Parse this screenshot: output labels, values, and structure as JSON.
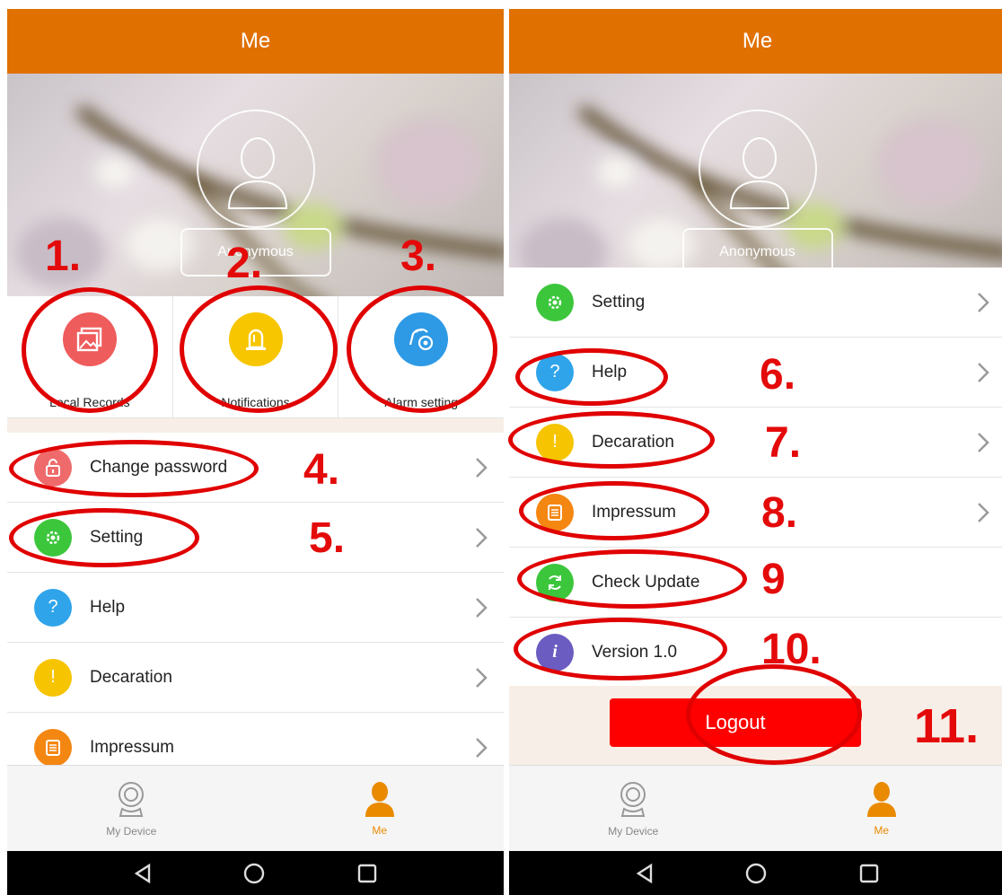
{
  "left": {
    "title": "Me",
    "user_name": "Anonymous",
    "quick_actions": [
      {
        "label": "Local Records"
      },
      {
        "label": "Notifications"
      },
      {
        "label": "Alarm setting"
      }
    ],
    "menu": [
      {
        "label": "Change password"
      },
      {
        "label": "Setting"
      },
      {
        "label": "Help"
      },
      {
        "label": "Decaration"
      },
      {
        "label": "Impressum"
      }
    ],
    "nav": [
      {
        "label": "My Device"
      },
      {
        "label": "Me"
      }
    ]
  },
  "right": {
    "title": "Me",
    "user_name": "Anonymous",
    "menu": [
      {
        "label": "Setting"
      },
      {
        "label": "Help"
      },
      {
        "label": "Decaration"
      },
      {
        "label": "Impressum"
      },
      {
        "label": "Check Update"
      },
      {
        "label": "Version 1.0"
      }
    ],
    "logout_label": "Logout",
    "nav": [
      {
        "label": "My Device"
      },
      {
        "label": "Me"
      }
    ]
  },
  "annotations": {
    "left": [
      "1.",
      "2.",
      "3.",
      "4.",
      "5."
    ],
    "right": [
      "6.",
      "7.",
      "8.",
      "9",
      "10.",
      "11."
    ]
  },
  "colors": {
    "topbar": "#e07000",
    "accent": "#e98a00",
    "annotation": "#e00000",
    "logout": "#ff0000"
  }
}
